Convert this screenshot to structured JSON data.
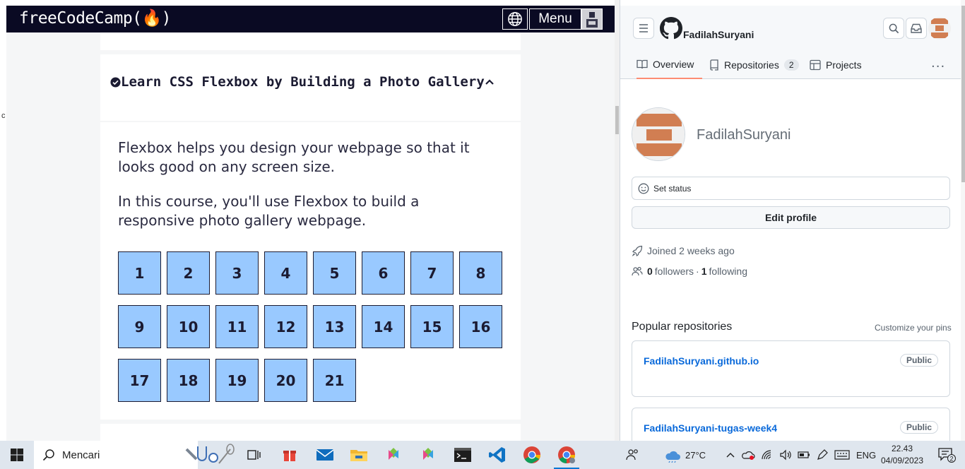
{
  "fcc": {
    "logo": "freeCodeCamp(🔥)",
    "menu_label": "Menu",
    "course_title": "Learn CSS Flexbox by Building a Photo Gallery",
    "description_1": "Flexbox helps you design your webpage so that it looks good on any screen size.",
    "description_2": "In this course, you'll use Flexbox to build a responsive photo gallery webpage.",
    "tiles": [
      "1",
      "2",
      "3",
      "4",
      "5",
      "6",
      "7",
      "8",
      "9",
      "10",
      "11",
      "12",
      "13",
      "14",
      "15",
      "16",
      "17",
      "18",
      "19",
      "20",
      "21"
    ],
    "left_edge_char": "c"
  },
  "github": {
    "username": "FadilahSuryani",
    "tabs": [
      {
        "label": "Overview"
      },
      {
        "label": "Repositories",
        "count": "2"
      },
      {
        "label": "Projects"
      }
    ],
    "more": "···",
    "profile_name": "FadilahSuryani",
    "set_status": "Set status",
    "edit_profile": "Edit profile",
    "joined": "Joined 2 weeks ago",
    "followers_count": "0",
    "followers_label": "followers",
    "separator": "·",
    "following_count": "1",
    "following_label": "following",
    "popular_title": "Popular repositories",
    "customize_pins": "Customize your pins",
    "repos": [
      {
        "name": "FadilahSuryani.github.io",
        "visibility": "Public"
      },
      {
        "name": "FadilahSuryani-tugas-week4",
        "visibility": "Public"
      }
    ],
    "avatar_colors": {
      "stripe": "#d17e52",
      "bg": "#f0f0f0"
    }
  },
  "taskbar": {
    "search_placeholder": "Mencari",
    "weather_temp": "27°C",
    "language": "ENG",
    "time": "22.43",
    "date": "04/09/2023",
    "notification_count": "2"
  }
}
